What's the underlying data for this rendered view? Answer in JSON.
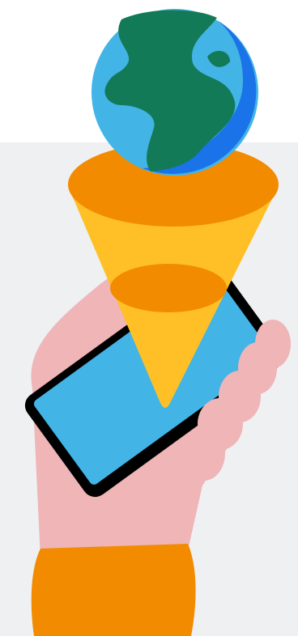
{
  "illustration": {
    "icon": "globe-funnel-phone-icon",
    "colors": {
      "background": "#ffffff",
      "panel": "#eff0f2",
      "ocean": "#42b4e6",
      "ocean_shade": "#1a73e8",
      "land": "#137a58",
      "funnel_rim": "#f28b00",
      "funnel_body": "#ffbf27",
      "phone_body": "#000000",
      "phone_screen": "#42b4e6",
      "hand": "#efb5b7",
      "sleeve": "#f28b00"
    }
  }
}
